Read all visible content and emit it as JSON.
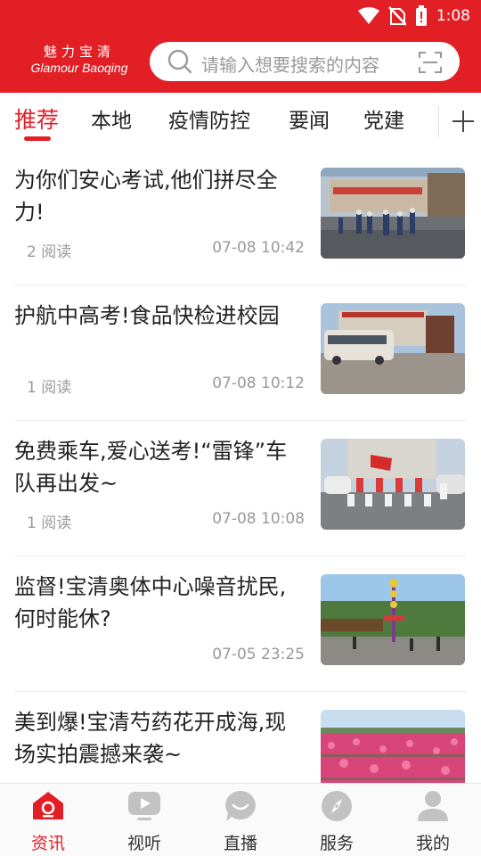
{
  "status_bar": {
    "time": "1:08",
    "icons": [
      "wifi-icon",
      "no-sim-icon",
      "battery-icon"
    ]
  },
  "header": {
    "logo_cn": "魅力宝清",
    "logo_en": "Glamour Baoqing",
    "search_placeholder": "请输入想要搜索的内容",
    "brand_color": "#e31f26"
  },
  "tabs": [
    {
      "label": "推荐",
      "active": true
    },
    {
      "label": "本地",
      "active": false
    },
    {
      "label": "疫情防控",
      "active": false
    },
    {
      "label": "要闻",
      "active": false
    },
    {
      "label": "党建",
      "active": false
    }
  ],
  "news": [
    {
      "title": "为你们安心考试,他们拼尽全力!",
      "reads": "2 阅读",
      "time": "07-08 10:42",
      "image": "exam-gate-photo"
    },
    {
      "title": "护航中高考!食品快检进校园",
      "reads": "1 阅读",
      "time": "07-08 10:12",
      "image": "bus-campus-photo"
    },
    {
      "title": "免费乘车,爱心送考!“雷锋”车队再出发~",
      "reads": "1 阅读",
      "time": "07-08 10:08",
      "image": "volunteer-group-photo"
    },
    {
      "title": "监督!宝清奥体中心噪音扰民,何时能休?",
      "reads": "",
      "time": "07-05 23:25",
      "image": "amusement-park-photo"
    },
    {
      "title": "美到爆!宝清芍药花开成海,现场实拍震撼来袭~",
      "reads": "",
      "time": "",
      "image": "peony-field-photo"
    }
  ],
  "bottom_nav": [
    {
      "label": "资讯",
      "icon": "news-house-icon",
      "active": true
    },
    {
      "label": "视听",
      "icon": "video-play-icon",
      "active": false
    },
    {
      "label": "直播",
      "icon": "live-chat-icon",
      "active": false
    },
    {
      "label": "服务",
      "icon": "compass-icon",
      "active": false
    },
    {
      "label": "我的",
      "icon": "user-icon",
      "active": false
    }
  ]
}
